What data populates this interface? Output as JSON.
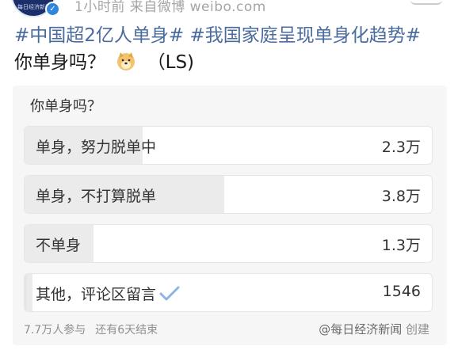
{
  "meta": {
    "avatar_text": "每日经济新闻",
    "timestamp_source": "1小时前  来自微博 weibo.com"
  },
  "post": {
    "tag1": "#中国超2亿人单身#",
    "tag2": "#我国家庭呈现单身化趋势#",
    "text": "你单身吗？",
    "suffix": "（LS)"
  },
  "poll": {
    "question": "你单身吗？",
    "options": [
      {
        "label": "单身，努力脱单中",
        "count": "2.3万",
        "share": 0.29
      },
      {
        "label": "单身，不打算脱单",
        "count": "3.8万",
        "share": 0.49
      },
      {
        "label": "不单身",
        "count": "1.3万",
        "share": 0.17
      },
      {
        "label": "其他，评论区留言",
        "count": "1546",
        "share": 0.02,
        "selected": true
      }
    ],
    "participants": "7.7万人参与",
    "remaining": "还有6天结束",
    "creator_name": "@每日经济新闻",
    "creator_suffix": "创建"
  },
  "colors": {
    "hashtag": "#496b9e",
    "check": "#8fb3e6",
    "bar_fill": "#ebebeb"
  }
}
